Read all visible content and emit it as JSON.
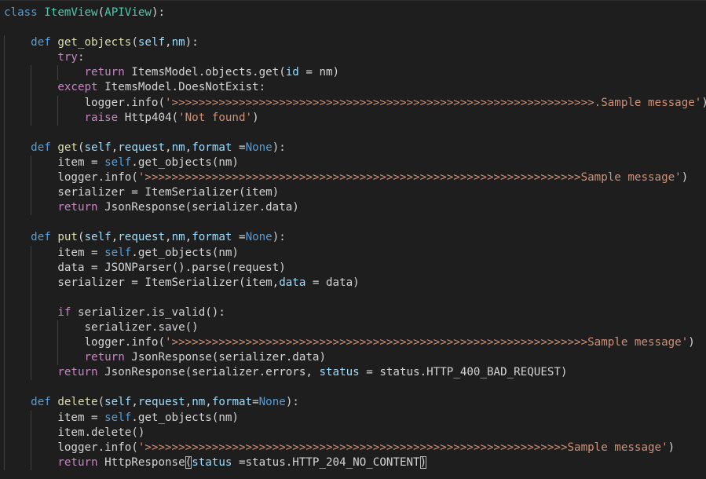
{
  "editor": {
    "colors": {
      "background": "#1e1e1e",
      "keyword": "#569cd6",
      "control": "#c586c0",
      "class": "#4ec9b0",
      "function": "#dcdcaa",
      "parameter": "#9cdcfe",
      "string": "#ce9178",
      "text": "#d4d4d4"
    },
    "lines": [
      [
        [
          "kw",
          "class"
        ],
        [
          "plain",
          " "
        ],
        [
          "cls",
          "ItemView"
        ],
        [
          "plain",
          "("
        ],
        [
          "cls",
          "APIView"
        ],
        [
          "plain",
          "):"
        ]
      ],
      [],
      [
        [
          "plain",
          "    "
        ],
        [
          "kw",
          "def"
        ],
        [
          "plain",
          " "
        ],
        [
          "fn",
          "get_objects"
        ],
        [
          "plain",
          "("
        ],
        [
          "param",
          "self"
        ],
        [
          "plain",
          ","
        ],
        [
          "param",
          "nm"
        ],
        [
          "plain",
          "):"
        ]
      ],
      [
        [
          "plain",
          "        "
        ],
        [
          "ctl",
          "try"
        ],
        [
          "plain",
          ":"
        ]
      ],
      [
        [
          "plain",
          "            "
        ],
        [
          "ctl",
          "return"
        ],
        [
          "plain",
          " ItemsModel.objects.get("
        ],
        [
          "param",
          "id"
        ],
        [
          "plain",
          " = nm)"
        ]
      ],
      [
        [
          "plain",
          "        "
        ],
        [
          "ctl",
          "except"
        ],
        [
          "plain",
          " ItemsModel.DoesNotExist:"
        ]
      ],
      [
        [
          "plain",
          "            logger.info("
        ],
        [
          "str",
          "'>>>>>>>>>>>>>>>>>>>>>>>>>>>>>>>>>>>>>>>>>>>>>>>>>>>>>>>>>>>>>>>.Sample message'"
        ],
        [
          "plain",
          ")"
        ]
      ],
      [
        [
          "plain",
          "            "
        ],
        [
          "ctl",
          "raise"
        ],
        [
          "plain",
          " Http404("
        ],
        [
          "str",
          "'Not found'"
        ],
        [
          "plain",
          ")"
        ]
      ],
      [],
      [
        [
          "plain",
          "    "
        ],
        [
          "kw",
          "def"
        ],
        [
          "plain",
          " "
        ],
        [
          "fn",
          "get"
        ],
        [
          "plain",
          "("
        ],
        [
          "param",
          "self"
        ],
        [
          "plain",
          ","
        ],
        [
          "param",
          "request"
        ],
        [
          "plain",
          ","
        ],
        [
          "param",
          "nm"
        ],
        [
          "plain",
          ","
        ],
        [
          "param",
          "format"
        ],
        [
          "plain",
          " ="
        ],
        [
          "const",
          "None"
        ],
        [
          "plain",
          "):"
        ]
      ],
      [
        [
          "plain",
          "        item = "
        ],
        [
          "self",
          "self"
        ],
        [
          "plain",
          ".get_objects(nm)"
        ]
      ],
      [
        [
          "plain",
          "        logger.info("
        ],
        [
          "str",
          "'>>>>>>>>>>>>>>>>>>>>>>>>>>>>>>>>>>>>>>>>>>>>>>>>>>>>>>>>>>>>>>>>>Sample message'"
        ],
        [
          "plain",
          ")"
        ]
      ],
      [
        [
          "plain",
          "        serializer = ItemSerializer(item)"
        ]
      ],
      [
        [
          "plain",
          "        "
        ],
        [
          "ctl",
          "return"
        ],
        [
          "plain",
          " JsonResponse(serializer.data)"
        ]
      ],
      [],
      [
        [
          "plain",
          "    "
        ],
        [
          "kw",
          "def"
        ],
        [
          "plain",
          " "
        ],
        [
          "fn",
          "put"
        ],
        [
          "plain",
          "("
        ],
        [
          "param",
          "self"
        ],
        [
          "plain",
          ","
        ],
        [
          "param",
          "request"
        ],
        [
          "plain",
          ","
        ],
        [
          "param",
          "nm"
        ],
        [
          "plain",
          ","
        ],
        [
          "param",
          "format"
        ],
        [
          "plain",
          " ="
        ],
        [
          "const",
          "None"
        ],
        [
          "plain",
          "):"
        ]
      ],
      [
        [
          "plain",
          "        item = "
        ],
        [
          "self",
          "self"
        ],
        [
          "plain",
          ".get_objects(nm)"
        ]
      ],
      [
        [
          "plain",
          "        data = JSONParser().parse(request)"
        ]
      ],
      [
        [
          "plain",
          "        serializer = ItemSerializer(item,"
        ],
        [
          "param",
          "data"
        ],
        [
          "plain",
          " = data)"
        ]
      ],
      [],
      [
        [
          "plain",
          "        "
        ],
        [
          "ctl",
          "if"
        ],
        [
          "plain",
          " serializer.is_valid():"
        ]
      ],
      [
        [
          "plain",
          "            serializer.save()"
        ]
      ],
      [
        [
          "plain",
          "            logger.info("
        ],
        [
          "str",
          "'>>>>>>>>>>>>>>>>>>>>>>>>>>>>>>>>>>>>>>>>>>>>>>>>>>>>>>>>>>>>>>Sample message'"
        ],
        [
          "plain",
          ")"
        ]
      ],
      [
        [
          "plain",
          "            "
        ],
        [
          "ctl",
          "return"
        ],
        [
          "plain",
          " JsonResponse(serializer.data)"
        ]
      ],
      [
        [
          "plain",
          "        "
        ],
        [
          "ctl",
          "return"
        ],
        [
          "plain",
          " JsonResponse(serializer.errors, "
        ],
        [
          "param",
          "status"
        ],
        [
          "plain",
          " = status.HTTP_400_BAD_REQUEST)"
        ]
      ],
      [],
      [
        [
          "plain",
          "    "
        ],
        [
          "kw",
          "def"
        ],
        [
          "plain",
          " "
        ],
        [
          "fn",
          "delete"
        ],
        [
          "plain",
          "("
        ],
        [
          "param",
          "self"
        ],
        [
          "plain",
          ","
        ],
        [
          "param",
          "request"
        ],
        [
          "plain",
          ","
        ],
        [
          "param",
          "nm"
        ],
        [
          "plain",
          ","
        ],
        [
          "param",
          "format"
        ],
        [
          "plain",
          "="
        ],
        [
          "const",
          "None"
        ],
        [
          "plain",
          "):"
        ]
      ],
      [
        [
          "plain",
          "        item = "
        ],
        [
          "self",
          "self"
        ],
        [
          "plain",
          ".get_objects(nm)"
        ]
      ],
      [
        [
          "plain",
          "        item.delete()"
        ]
      ],
      [
        [
          "plain",
          "        logger.info("
        ],
        [
          "str",
          "'>>>>>>>>>>>>>>>>>>>>>>>>>>>>>>>>>>>>>>>>>>>>>>>>>>>>>>>>>>>>>>>Sample message'"
        ],
        [
          "plain",
          ")"
        ]
      ],
      [
        [
          "plain",
          "        "
        ],
        [
          "ctl",
          "return"
        ],
        [
          "plain",
          " HttpResponse"
        ],
        [
          "bracket",
          "("
        ],
        [
          "param",
          "status"
        ],
        [
          "plain",
          " =status.HTTP_204_NO_CONTENT"
        ],
        [
          "bracket",
          ")"
        ]
      ]
    ],
    "indent_guides": [
      [],
      [],
      [
        0
      ],
      [
        0
      ],
      [
        0,
        1,
        2
      ],
      [
        0,
        1
      ],
      [
        0,
        1,
        2
      ],
      [
        0,
        1,
        2
      ],
      [
        0
      ],
      [
        0
      ],
      [
        0,
        1
      ],
      [
        0,
        1
      ],
      [
        0,
        1
      ],
      [
        0,
        1
      ],
      [
        0
      ],
      [
        0
      ],
      [
        0,
        1
      ],
      [
        0,
        1
      ],
      [
        0,
        1
      ],
      [
        0,
        1
      ],
      [
        0,
        1
      ],
      [
        0,
        1,
        2
      ],
      [
        0,
        1,
        2
      ],
      [
        0,
        1,
        2
      ],
      [
        0,
        1
      ],
      [
        0
      ],
      [
        0
      ],
      [
        0,
        1
      ],
      [
        0,
        1
      ],
      [
        0,
        1
      ],
      [
        0,
        1
      ]
    ],
    "current_line": 31
  }
}
